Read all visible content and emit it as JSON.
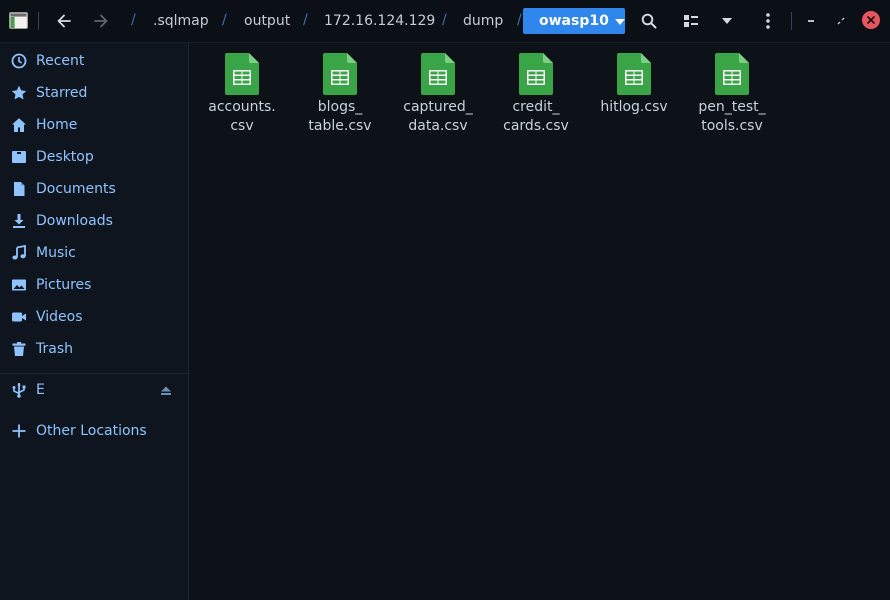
{
  "path": {
    "crumbs": [
      ".sqlmap",
      "output",
      "172.16.124.129",
      "dump"
    ],
    "current": "owasp10"
  },
  "sidebar": {
    "places": [
      {
        "label": "Recent",
        "icon": "clock-icon"
      },
      {
        "label": "Starred",
        "icon": "star-icon"
      },
      {
        "label": "Home",
        "icon": "home-icon"
      },
      {
        "label": "Desktop",
        "icon": "desktop-icon"
      },
      {
        "label": "Documents",
        "icon": "document-icon"
      },
      {
        "label": "Downloads",
        "icon": "download-icon"
      },
      {
        "label": "Music",
        "icon": "music-icon"
      },
      {
        "label": "Pictures",
        "icon": "picture-icon"
      },
      {
        "label": "Videos",
        "icon": "video-icon"
      },
      {
        "label": "Trash",
        "icon": "trash-icon"
      }
    ],
    "devices": [
      {
        "label": "E",
        "icon": "usb-icon"
      }
    ],
    "other": {
      "label": "Other Locations",
      "icon": "plus-icon"
    }
  },
  "files": [
    {
      "name": "accounts.\ncsv"
    },
    {
      "name": "blogs_\ntable.csv"
    },
    {
      "name": "captured_\ndata.csv"
    },
    {
      "name": "credit_\ncards.csv"
    },
    {
      "name": "hitlog.csv"
    },
    {
      "name": "pen_test_\ntools.csv"
    }
  ],
  "colors": {
    "accent": "#2f86ec",
    "sidebar_text": "#8fc3ff",
    "spreadsheet_green": "#3aa547",
    "close_red": "#e5575f"
  }
}
